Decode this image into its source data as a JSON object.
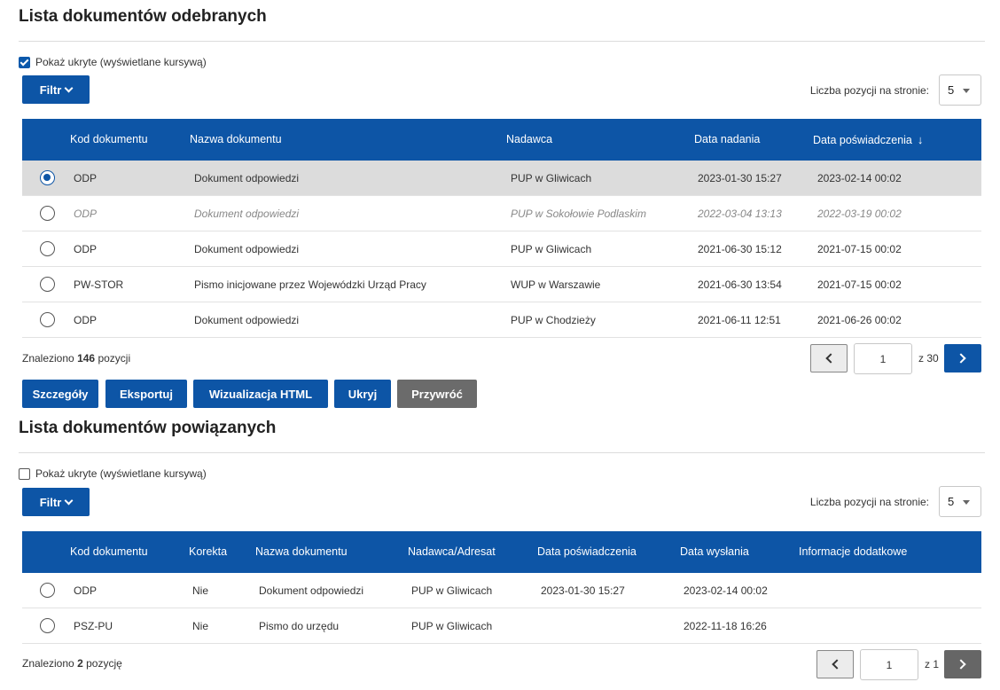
{
  "received": {
    "title": "Lista dokumentów odebranych",
    "show_hidden_label": "Pokaż ukryte (wyświetlane kursywą)",
    "show_hidden_checked": true,
    "filter_label": "Filtr",
    "per_page_label": "Liczba pozycji na stronie:",
    "per_page_value": "5",
    "columns": [
      "Kod dokumentu",
      "Nazwa dokumentu",
      "Nadawca",
      "Data nadania",
      "Data poświadczenia"
    ],
    "sort_icon": "arrow-down-icon",
    "rows": [
      {
        "kod": "ODP",
        "nazwa": "Dokument odpowiedzi",
        "nadawca": "PUP w Gliwicach",
        "data_nadania": "2023-01-30 15:27",
        "data_poswiadczenia": "2023-02-14 00:02"
      },
      {
        "kod": "ODP",
        "nazwa": "Dokument odpowiedzi",
        "nadawca": "PUP w Sokołowie Podlaskim",
        "data_nadania": "2022-03-04 13:13",
        "data_poswiadczenia": "2022-03-19 00:02"
      },
      {
        "kod": "ODP",
        "nazwa": "Dokument odpowiedzi",
        "nadawca": "PUP w Gliwicach",
        "data_nadania": "2021-06-30 15:12",
        "data_poswiadczenia": "2021-07-15 00:02"
      },
      {
        "kod": "PW-STOR",
        "nazwa": "Pismo inicjowane przez Wojewódzki Urząd Pracy",
        "nadawca": "WUP w Warszawie",
        "data_nadania": "2021-06-30 13:54",
        "data_poswiadczenia": "2021-07-15 00:02"
      },
      {
        "kod": "ODP",
        "nazwa": "Dokument odpowiedzi",
        "nadawca": "PUP w Chodzieży",
        "data_nadania": "2021-06-11 12:51",
        "data_poswiadczenia": "2021-06-26 00:02"
      }
    ],
    "found_prefix": "Znaleziono",
    "found_count": "146",
    "found_suffix": "pozycji",
    "page_value": "1",
    "page_total": "z 30"
  },
  "actions": {
    "details": "Szczegóły",
    "export": "Eksportuj",
    "html_view": "Wizualizacja HTML",
    "hide": "Ukryj",
    "restore": "Przywróć"
  },
  "related": {
    "title": "Lista dokumentów powiązanych",
    "show_hidden_label": "Pokaż ukryte (wyświetlane kursywą)",
    "show_hidden_checked": false,
    "filter_label": "Filtr",
    "per_page_label": "Liczba pozycji na stronie:",
    "per_page_value": "5",
    "columns": [
      "Kod dokumentu",
      "Korekta",
      "Nazwa dokumentu",
      "Nadawca/Adresat",
      "Data poświadczenia",
      "Data wysłania",
      "Informacje dodatkowe"
    ],
    "rows": [
      {
        "kod": "ODP",
        "korekta": "Nie",
        "nazwa": "Dokument odpowiedzi",
        "nadawca": "PUP w Gliwicach",
        "data_poswiadczenia": "2023-01-30 15:27",
        "data_wyslania": "2023-02-14 00:02",
        "info": ""
      },
      {
        "kod": "PSZ-PU",
        "korekta": "Nie",
        "nazwa": "Pismo do urzędu",
        "nadawca": "PUP w Gliwicach",
        "data_poswiadczenia": "",
        "data_wyslania": "2022-11-18 16:26",
        "info": ""
      }
    ],
    "found_prefix": "Znaleziono",
    "found_count": "2",
    "found_suffix": "pozycję",
    "page_value": "1",
    "page_total": "z 1"
  },
  "colors": {
    "primary": "#0d55a6",
    "selected_row": "#dcdcdc",
    "disabled": "#6b6b6b"
  }
}
